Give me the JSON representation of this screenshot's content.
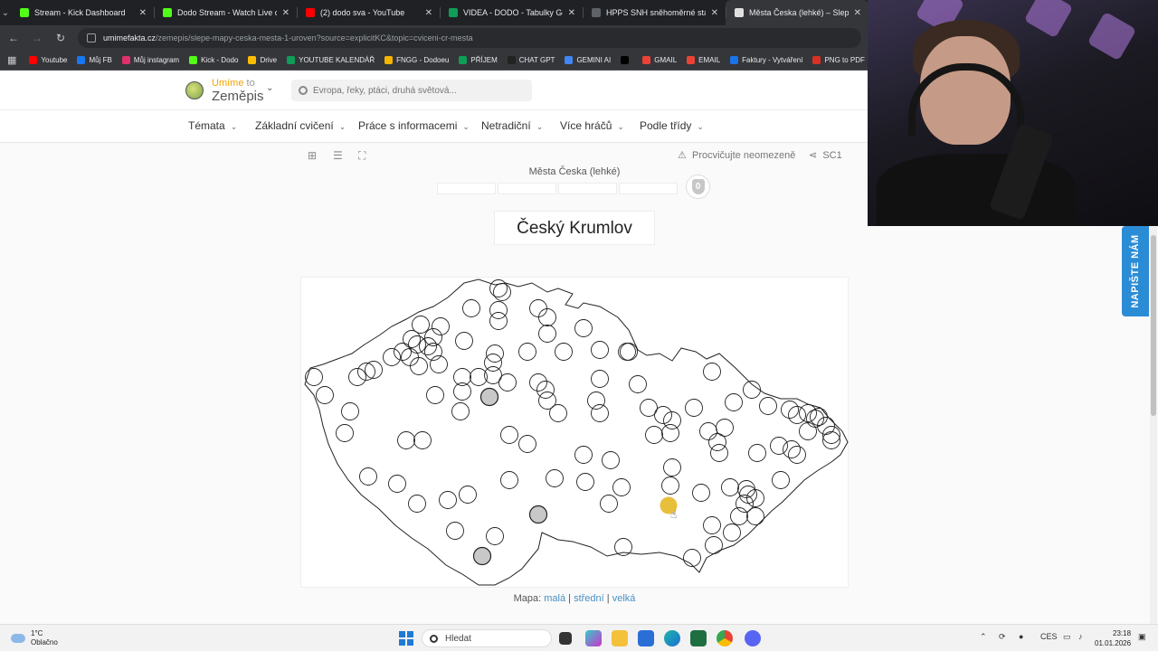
{
  "browser": {
    "tabs": [
      {
        "title": "Stream - Kick Dashboard",
        "color": "#53fc18"
      },
      {
        "title": "Dodo Stream - Watch Live on K",
        "color": "#53fc18"
      },
      {
        "title": "(2) dodo sva - YouTube",
        "color": "#ff0000"
      },
      {
        "title": "VIDEA - DODO - Tabulky Googl",
        "color": "#0f9d58"
      },
      {
        "title": "HPPS SNH sněhoměrné stanice",
        "color": "#5f6368"
      },
      {
        "title": "Města Česka (lehké) – Slepé m",
        "color": "#e0e0e0"
      }
    ],
    "url_host": "umimefakta.cz",
    "url_path": "/zemepis/slepe-mapy-ceska-mesta-1-uroven?source=explicitKC&topic=cviceni-cr-mesta",
    "bookmarks": [
      {
        "label": "Youtube",
        "color": "#ff0000"
      },
      {
        "label": "Můj FB",
        "color": "#1877f2"
      },
      {
        "label": "Můj instagram",
        "color": "#e1306c"
      },
      {
        "label": "Kick - Dodo",
        "color": "#53fc18"
      },
      {
        "label": "Drive",
        "color": "#fbbc04"
      },
      {
        "label": "YOUTUBE KALENDÁŘ",
        "color": "#0f9d58"
      },
      {
        "label": "FNGG - Dodoeu",
        "color": "#f4b400"
      },
      {
        "label": "PŘÍJEM",
        "color": "#0f9d58"
      },
      {
        "label": "CHAT GPT",
        "color": "#222222"
      },
      {
        "label": "GEMINI AI",
        "color": "#4285f4"
      },
      {
        "label": "",
        "color": "#000000"
      },
      {
        "label": "GMAIL",
        "color": "#ea4335"
      },
      {
        "label": "EMAIL",
        "color": "#ea4335"
      },
      {
        "label": "Faktury - Vytváření",
        "color": "#1a73e8"
      },
      {
        "label": "PNG to PDF",
        "color": "#d93025"
      }
    ]
  },
  "site": {
    "logo_top_a": "Umíme",
    "logo_top_b": " to",
    "logo_main": "Zeměpis",
    "search_placeholder": "Evropa, řeky, ptáci, druhá světová...",
    "nav": [
      "Témata",
      "Základní cvičení",
      "Práce s informacemi",
      "Netradiční",
      "Více hráčů",
      "Podle třídy"
    ],
    "practice_label": "Procvičujte neomezeně",
    "share_label": "SC1",
    "task_title": "Města Česka (lehké)",
    "score": "0",
    "question": "Český Krumlov",
    "map_size_label": "Mapa:",
    "map_size_options": [
      "malá",
      "střední",
      "velká"
    ],
    "feedback_label": "NAPIŠTE NÁM"
  },
  "taskbar": {
    "weather_temp": "1°C",
    "weather_desc": "Oblačno",
    "search_label": "Hledat",
    "lang": "CES",
    "time": "23:18",
    "date": "01.01.2026"
  },
  "map_colors": {
    "highlight": "#e8bf3a",
    "answered": "#c8c8c8"
  }
}
